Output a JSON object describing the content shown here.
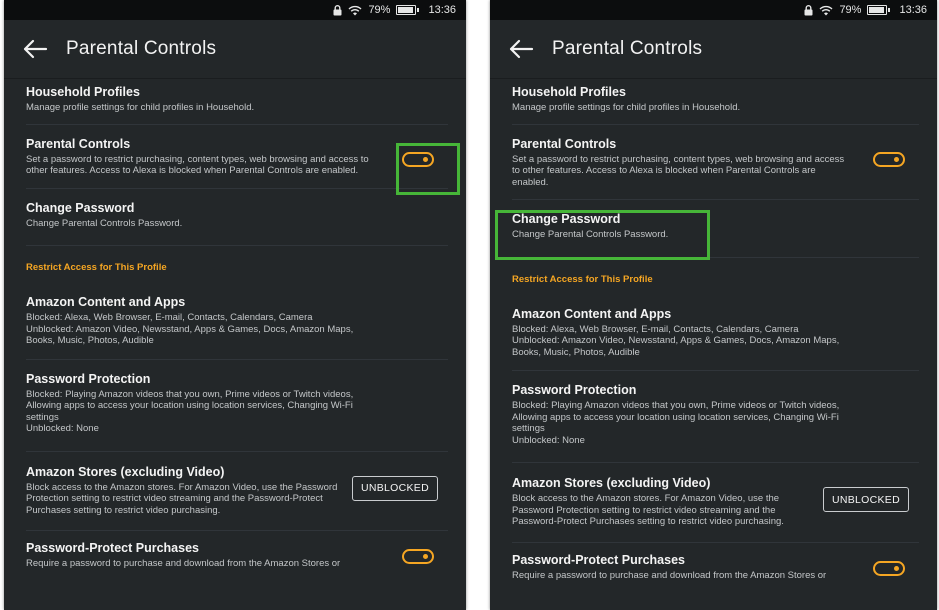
{
  "status": {
    "battery": "79%",
    "time": "13:36",
    "battery_level": 0.79
  },
  "header": {
    "title": "Parental Controls"
  },
  "settings": {
    "household": {
      "title": "Household Profiles",
      "desc": "Manage profile settings for child profiles in Household."
    },
    "parental": {
      "title": "Parental Controls",
      "desc": "Set a password to restrict purchasing, content types, web browsing and access to other features. Access to Alexa is blocked when Parental Controls are enabled.",
      "enabled": true
    },
    "password": {
      "title": "Change Password",
      "desc": "Change Parental Controls Password."
    },
    "section_header": "Restrict Access for This Profile",
    "content_apps": {
      "title": "Amazon Content and Apps",
      "desc": "Blocked: Alexa, Web Browser, E-mail, Contacts, Calendars, Camera\nUnblocked: Amazon Video, Newsstand, Apps & Games, Docs, Amazon Maps, Books, Music, Photos, Audible"
    },
    "protection": {
      "title": "Password Protection",
      "desc": "Blocked: Playing Amazon videos that you own, Prime videos or Twitch videos, Allowing apps to access your location using location services, Changing Wi-Fi settings\nUnblocked: None"
    },
    "stores": {
      "title": "Amazon Stores (excluding Video)",
      "desc": "Block access to the Amazon stores. For Amazon Video, use the Password Protection setting to restrict video streaming and the Password-Protect Purchases setting to restrict video purchasing.",
      "button_label": "UNBLOCKED"
    },
    "purchases": {
      "title": "Password-Protect Purchases",
      "desc": "Require a password to purchase and download from the Amazon Stores or",
      "enabled": true
    }
  },
  "colors": {
    "accent": "#f5a623",
    "highlight": "#46b638",
    "background": "#232729"
  }
}
